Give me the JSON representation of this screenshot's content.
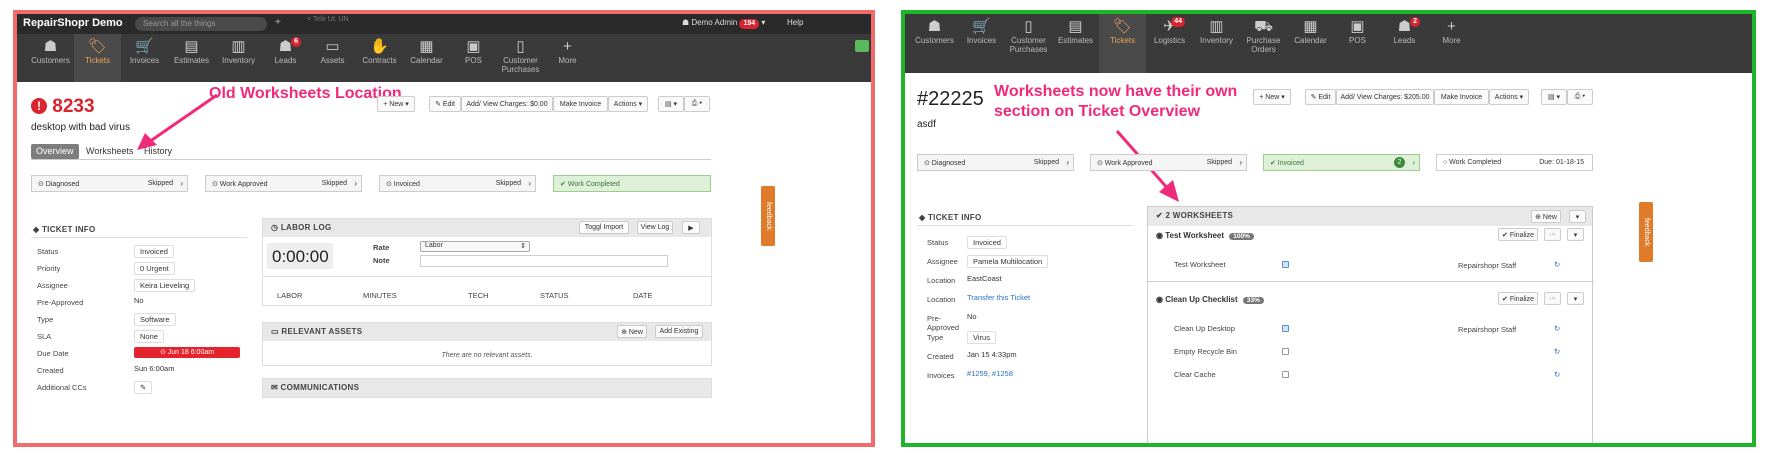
{
  "left": {
    "brand": "RepairShopr Demo",
    "search_placeholder": "Search all the things",
    "add_glyph": "+",
    "faint_text": "< Tele Ut: UN",
    "admin": "Demo Admin",
    "admin_badge": "194",
    "help": "Help",
    "nav": [
      {
        "label": "Customers",
        "icon": "users-icon",
        "glyph": "☗"
      },
      {
        "label": "Tickets",
        "icon": "tag-icon",
        "glyph": "🏷",
        "active": true
      },
      {
        "label": "Invoices",
        "icon": "cart-icon",
        "glyph": "🛒"
      },
      {
        "label": "Estimates",
        "icon": "document-icon",
        "glyph": "▤"
      },
      {
        "label": "Inventory",
        "icon": "barcode-icon",
        "glyph": "▥"
      },
      {
        "label": "Leads",
        "icon": "person-icon",
        "glyph": "☗",
        "badge": "6"
      },
      {
        "label": "Assets",
        "icon": "monitor-icon",
        "glyph": "▭"
      },
      {
        "label": "Contracts",
        "icon": "handshake-icon",
        "glyph": "✋"
      },
      {
        "label": "Calendar",
        "icon": "calendar-icon",
        "glyph": "▦"
      },
      {
        "label": "POS",
        "icon": "cash-icon",
        "glyph": "▣"
      },
      {
        "label": "Customer\nPurchases",
        "icon": "mobile-icon",
        "glyph": "▯"
      },
      {
        "label": "More",
        "icon": "plus-icon",
        "glyph": "+"
      }
    ],
    "ticket_number": "8233",
    "ticket_title": "desktop with bad virus",
    "annotation": "Old Worksheets Location",
    "toolbar": {
      "new": "+ New ▾",
      "edit": "✎ Edit",
      "charges": "Add/ View Charges: $0.00",
      "make_invoice": "Make Invoice",
      "actions": "Actions ▾",
      "pdf": "▤ ▾",
      "print": "⎙ ▾"
    },
    "tabs": [
      "Overview",
      "Worksheets",
      "History"
    ],
    "steps": [
      {
        "label": "⊙ Diagnosed",
        "status": "Skipped"
      },
      {
        "label": "⊙ Work Approved",
        "status": "Skipped"
      },
      {
        "label": "⊙ Invoiced",
        "status": "Skipped"
      },
      {
        "label": "✔ Work Completed",
        "status": ""
      }
    ],
    "ticket_info": {
      "heading": "TICKET INFO",
      "rows": [
        {
          "label": "Status",
          "value": "Invoiced"
        },
        {
          "label": "Priority",
          "value": "0 Urgent"
        },
        {
          "label": "Assignee",
          "value": "Keira Lieveling"
        },
        {
          "label": "Pre-Approved",
          "value": "No"
        },
        {
          "label": "Type",
          "value": "Software"
        },
        {
          "label": "SLA",
          "value": "None"
        },
        {
          "label": "Due Date",
          "value": "⊙ Jun 18 6:00am"
        },
        {
          "label": "Created",
          "value": "Sun 6:00am"
        },
        {
          "label": "Additional CCs",
          "value": "✎"
        }
      ]
    },
    "labor": {
      "heading": "LABOR LOG",
      "toggle": "Toggl Import",
      "view": "View Log",
      "play": "▶",
      "timer": "0:00:00",
      "rate_label": "Rate",
      "rate_value": "Labor",
      "note_label": "Note",
      "columns": [
        "LABOR",
        "MINUTES",
        "TECH",
        "STATUS",
        "DATE"
      ]
    },
    "assets": {
      "heading": "RELEVANT ASSETS",
      "new": "⊕ New",
      "add": "Add Existing",
      "empty": "There are no relevant assets."
    },
    "communications": "COMMUNICATIONS",
    "feedback": "feedback"
  },
  "right": {
    "nav": [
      {
        "label": "Customers",
        "icon": "users-icon",
        "glyph": "☗"
      },
      {
        "label": "Invoices",
        "icon": "cart-icon",
        "glyph": "🛒"
      },
      {
        "label": "Customer\nPurchases",
        "icon": "mobile-icon",
        "glyph": "▯"
      },
      {
        "label": "Estimates",
        "icon": "document-icon",
        "glyph": "▤"
      },
      {
        "label": "Tickets",
        "icon": "tag-icon",
        "glyph": "🏷",
        "active": true
      },
      {
        "label": "Logistics",
        "icon": "plane-icon",
        "glyph": "✈",
        "badge": "44"
      },
      {
        "label": "Inventory",
        "icon": "barcode-icon",
        "glyph": "▥"
      },
      {
        "label": "Purchase\nOrders",
        "icon": "truck-icon",
        "glyph": "⛟"
      },
      {
        "label": "Calendar",
        "icon": "calendar-icon",
        "glyph": "▦"
      },
      {
        "label": "POS",
        "icon": "cash-icon",
        "glyph": "▣"
      },
      {
        "label": "Leads",
        "icon": "person-icon",
        "glyph": "☗",
        "badge": "2"
      },
      {
        "label": "More",
        "icon": "plus-icon",
        "glyph": "+"
      }
    ],
    "ticket_number": "#22225",
    "ticket_title": "asdf",
    "annotation_line1": "Worksheets now have their own",
    "annotation_line2": "section on Ticket Overview",
    "toolbar": {
      "new": "+ New ▾",
      "edit": "✎ Edit",
      "charges": "Add/ View Charges: $205.00",
      "make_invoice": "Make Invoice",
      "actions": "Actions ▾",
      "pdf": "▤ ▾",
      "print": "⎙ ▾"
    },
    "steps": [
      {
        "label": "⊙ Diagnosed",
        "status": "Skipped"
      },
      {
        "label": "⊙ Work Approved",
        "status": "Skipped"
      },
      {
        "label": "✔ Invoiced",
        "status": "2"
      },
      {
        "label": "○ Work Completed",
        "status": "Due: 01-18-15"
      }
    ],
    "ticket_info": {
      "heading": "TICKET INFO",
      "rows": [
        {
          "label": "Status",
          "value": "Invoiced"
        },
        {
          "label": "Assignee",
          "value": "Pamela Multilocation"
        },
        {
          "label": "Location",
          "value": "EastCoast"
        },
        {
          "label": "Location",
          "value": "Transfer this Ticket"
        },
        {
          "label": "Pre-\nApproved",
          "value": "No"
        },
        {
          "label": "Type",
          "value": "Virus"
        },
        {
          "label": "Created",
          "value": "Jan 15 4:33pm"
        },
        {
          "label": "Invoices",
          "value": "#1259, #1258"
        }
      ]
    },
    "worksheets": {
      "heading": "2 WORKSHEETS",
      "new": "⊕ New",
      "caret": "▾",
      "sheets": [
        {
          "title": "Test Worksheet",
          "pct": "100%",
          "finalize": "✔ Finalize",
          "items": [
            {
              "label": "Test Worksheet",
              "checked": true,
              "by": "Repairshopr Staff"
            }
          ]
        },
        {
          "title": "Clean Up Checklist",
          "pct": "33%",
          "finalize": "✔ Finalize",
          "items": [
            {
              "label": "Clean Up Desktop",
              "checked": true,
              "by": "Repairshopr Staff"
            },
            {
              "label": "Empty Recycle Bin",
              "checked": false,
              "by": ""
            },
            {
              "label": "Clear Cache",
              "checked": false,
              "by": ""
            }
          ]
        }
      ]
    },
    "feedback": "feedback"
  }
}
